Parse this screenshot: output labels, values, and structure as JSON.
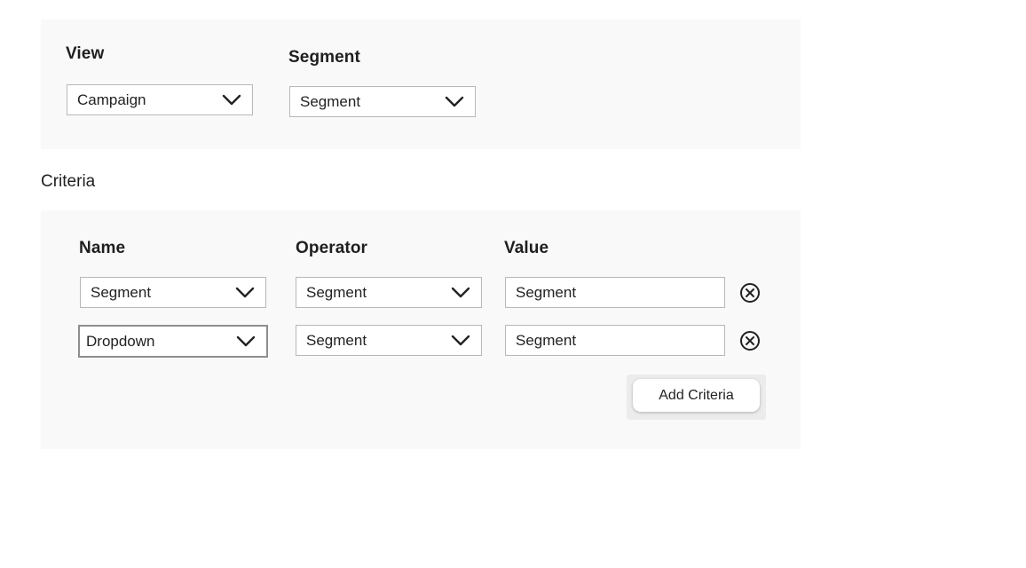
{
  "view_section": {
    "view_label": "View",
    "view_value": "Campaign",
    "segment_label": "Segment",
    "segment_value": "Segment"
  },
  "criteria": {
    "heading": "Criteria",
    "columns": {
      "name": "Name",
      "operator": "Operator",
      "value": "Value"
    },
    "rows": [
      {
        "name": "Segment",
        "operator": "Segment",
        "value": "Segment"
      },
      {
        "name": "Dropdown",
        "operator": "Segment",
        "value": "Segment"
      }
    ],
    "add_button_label": "Add Criteria"
  },
  "icons": {
    "dropdown": "chevron-down-icon",
    "remove": "close-circle-icon"
  },
  "colors": {
    "panel_bg": "#f9f9f9",
    "border": "#b8b8b8",
    "text": "#1f1f1f"
  }
}
